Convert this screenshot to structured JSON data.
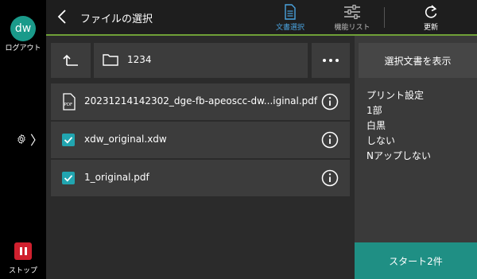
{
  "sidebar": {
    "avatar_text": "dw",
    "logout_label": "ログアウト",
    "stop_label": "ストップ"
  },
  "header": {
    "title": "ファイルの選択",
    "doc_select_label": "文書選択",
    "function_list_label": "機能リスト",
    "refresh_label": "更新"
  },
  "toolbar": {
    "path": "1234"
  },
  "files": [
    {
      "name": "20231214142302_dge-fb-apeoscc-dw...iginal.pdf",
      "type_label": "PDF",
      "checked": false
    },
    {
      "name": "xdw_original.xdw",
      "checked": true
    },
    {
      "name": "1_original.pdf",
      "checked": true
    }
  ],
  "right_panel": {
    "show_selected_label": "選択文書を表示",
    "print_settings": {
      "heading": "プリント設定",
      "copies": "1部",
      "color": "白黒",
      "duplex": "しない",
      "nup": "Nアップしない"
    },
    "start_label": "スタート2件"
  },
  "colors": {
    "accent_blue": "#4aa3df",
    "accent_green_line": "#6fa037",
    "checkbox_teal": "#21a5b0",
    "start_button": "#1f8f84",
    "stop_red": "#d0202e",
    "avatar_teal": "#1a9a8a"
  }
}
